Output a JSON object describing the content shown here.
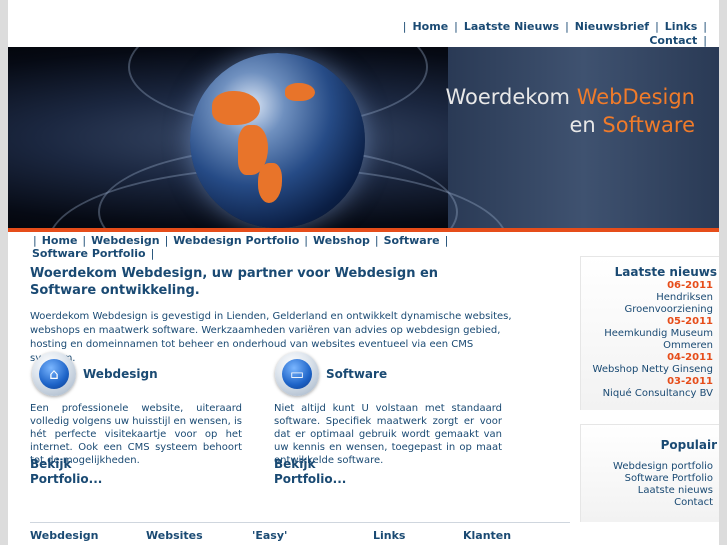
{
  "top_nav": [
    "Home",
    "Laatste Nieuws",
    "Nieuwsbrief",
    "Links",
    "Contact"
  ],
  "banner": {
    "title_line1": "Woerdekom",
    "title_line1_accent": "WebDesign",
    "title_line2": "en",
    "title_line2_accent": "Software"
  },
  "main_nav": [
    "Home",
    "Webdesign",
    "Webdesign Portfolio",
    "Webshop",
    "Software",
    "Software Portfolio"
  ],
  "headline": "Woerdekom Webdesign, uw partner voor Webdesign en Software ontwikkeling.",
  "intro": "Woerdekom Webdesign is gevestigd in Lienden, Gelderland en ontwikkelt dynamische websites, webshops en maatwerk software. Werkzaamheden variëren van advies op webdesign gebied, hosting en domeinnamen tot beheer en  onderhoud van websites eventueel via een CMS systeem.",
  "services": [
    {
      "title": "Webdesign",
      "text": "Een professionele website, uiteraard volledig volgens uw huisstijl en wensen, is hét perfecte visitekaartje voor op het internet. Ook een CMS systeem behoort tot de mogelijkheden.",
      "link": "Bekijk Portfolio..."
    },
    {
      "title": "Software",
      "text": "Niet altijd kunt U volstaan met standaard software. Specifiek maatwerk zorgt er voor dat er optimaal gebruik wordt gemaakt van uw kennis en wensen, toegepast in op maat ontwikkelde software.",
      "link": "Bekijk Portfolio..."
    }
  ],
  "sidebar": {
    "news_title": "Laatste nieuws",
    "news": [
      {
        "date": "06-2011",
        "title": "Hendriksen Groenvoorziening"
      },
      {
        "date": "05-2011",
        "title": "Heemkundig Museum Ommeren"
      },
      {
        "date": "04-2011",
        "title": "Webshop Netty Ginseng"
      },
      {
        "date": "03-2011",
        "title": "Niqué Consultancy BV"
      }
    ],
    "popular_title": "Populair",
    "popular": [
      "Webdesign portfolio",
      "Software Portfolio",
      "Laatste nieuws",
      "Contact"
    ]
  },
  "footer": [
    "Webdesign",
    "Websites",
    "'Easy'",
    "Links",
    "Klanten"
  ],
  "colors": {
    "brand_blue": "#1a4a73",
    "accent_orange": "#e64d1a"
  }
}
